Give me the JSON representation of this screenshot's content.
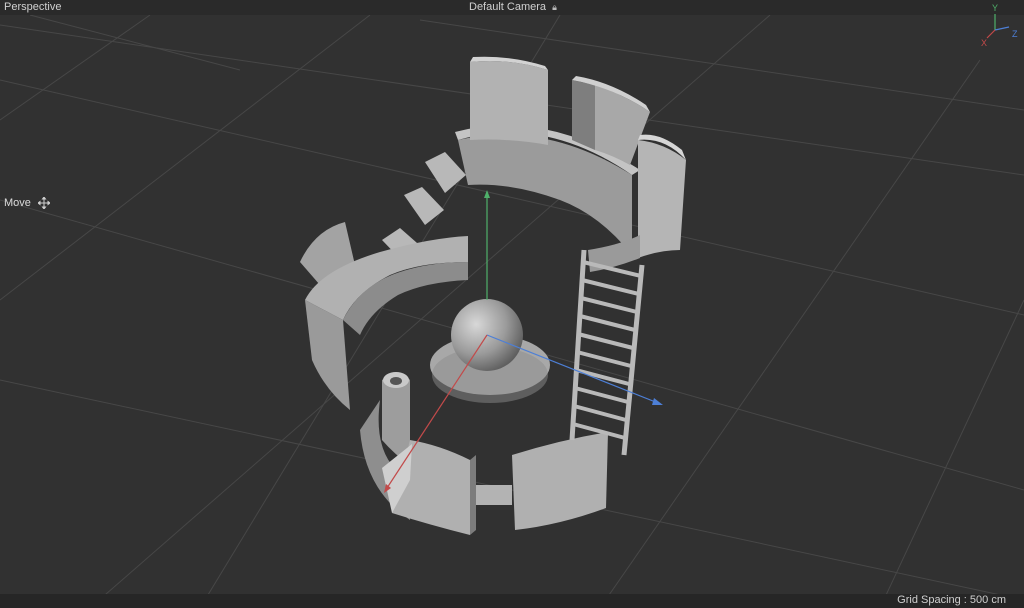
{
  "viewport": {
    "view_name": "Perspective",
    "camera_name": "Default Camera",
    "camera_icon": "lock-icon",
    "tool_label": "Move",
    "tool_icon": "move-icon",
    "grid_spacing": "Grid Spacing : 500 cm"
  },
  "axis_gizmo": {
    "x": "X",
    "y": "Y",
    "z": "Z"
  },
  "colors": {
    "background": "#313131",
    "grid": "#474747",
    "geometry": "#a6a6a6",
    "axis_x": "#c24a4a",
    "axis_y": "#4fb06a",
    "axis_z": "#4d7fd6"
  }
}
